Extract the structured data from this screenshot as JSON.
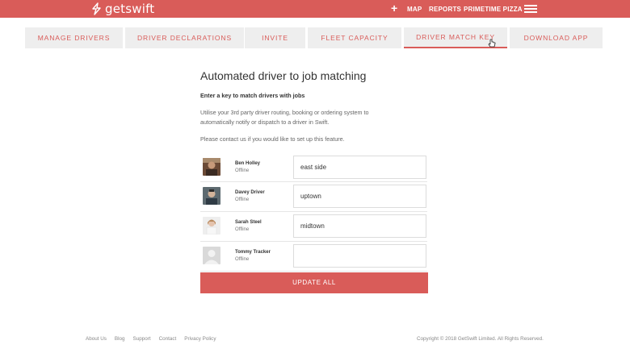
{
  "brand": {
    "name": "getswift",
    "color": "#d95c59"
  },
  "topnav": {
    "plus_icon": "plus-icon",
    "links": [
      "MAP",
      "REPORTS",
      "PRIMETIME PIZZA"
    ],
    "menu_icon": "hamburger-icon"
  },
  "tabs": [
    {
      "label": "MANAGE DRIVERS",
      "active": false
    },
    {
      "label": "DRIVER DECLARATIONS",
      "active": false
    },
    {
      "label": "INVITE",
      "active": false
    },
    {
      "label": "FLEET CAPACITY",
      "active": false
    },
    {
      "label": "DRIVER MATCH KEY",
      "active": true
    },
    {
      "label": "DOWNLOAD APP",
      "active": false
    }
  ],
  "main": {
    "title": "Automated driver to job matching",
    "subtitle": "Enter a key to match drivers with jobs",
    "description_line1": "Utilise your 3rd party driver routing, booking or ordering system to",
    "description_line2": "automatically notify or dispatch to a driver in Swift.",
    "contact": "Please contact us if you would like to set up this feature."
  },
  "drivers": [
    {
      "name": "Ben Holley",
      "status": "Offline",
      "key": "east side",
      "avatar": "photo-avatar"
    },
    {
      "name": "Davey Driver",
      "status": "Offline",
      "key": "uptown",
      "avatar": "photo-avatar"
    },
    {
      "name": "Sarah Steel",
      "status": "Offline",
      "key": "midtown",
      "avatar": "photo-avatar"
    },
    {
      "name": "Tommy Tracker",
      "status": "Offline",
      "key": "",
      "avatar": "default-avatar"
    }
  ],
  "update_button": "UPDATE ALL",
  "footer": {
    "links": [
      "About Us",
      "Blog",
      "Support",
      "Contact",
      "Privacy Policy"
    ],
    "copyright": "Copyright © 2018 GetSwift Limited. All Rights Reserved."
  }
}
